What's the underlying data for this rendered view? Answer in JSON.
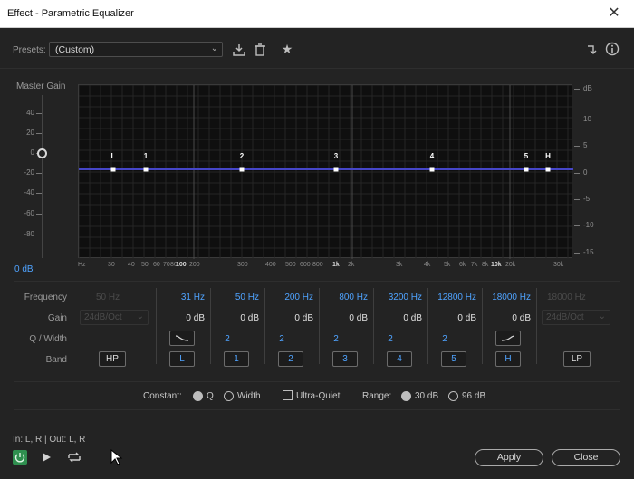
{
  "window": {
    "title": "Effect - Parametric Equalizer",
    "close_icon": "close-icon"
  },
  "presets": {
    "label": "Presets:",
    "value": "(Custom)"
  },
  "toolbar_icons": [
    "save-preset-icon",
    "delete-preset-icon",
    "favorite-star-icon",
    "routing-icon",
    "info-icon"
  ],
  "master_gain": {
    "label": "Master Gain",
    "value": "0 dB",
    "ticks": [
      "40",
      "20",
      "0",
      "-20",
      "-40",
      "-60",
      "-80"
    ]
  },
  "graph": {
    "db_ticks": [
      "dB",
      "10",
      "5",
      "0",
      "-5",
      "-10",
      "-15"
    ],
    "freq_ticks": [
      "Hz",
      "30",
      "40",
      "50",
      "60",
      "70",
      "80",
      "100",
      "200",
      "300",
      "400",
      "500",
      "600",
      "800",
      "1k",
      "2k",
      "3k",
      "4k",
      "5k",
      "6k",
      "7k",
      "8k",
      "10k",
      "20k",
      "30k"
    ],
    "handles": [
      "L",
      "1",
      "2",
      "3",
      "4",
      "5",
      "H"
    ]
  },
  "table": {
    "row_labels": {
      "frequency": "Frequency",
      "gain": "Gain",
      "q": "Q / Width",
      "band": "Band"
    },
    "hp": {
      "freq": "50 Hz",
      "gain": "24dB/Oct",
      "band": "HP"
    },
    "bands": [
      {
        "freq": "31 Hz",
        "gain": "0 dB",
        "band": "L"
      },
      {
        "freq": "50 Hz",
        "gain": "0 dB",
        "q": "2",
        "band": "1"
      },
      {
        "freq": "200 Hz",
        "gain": "0 dB",
        "q": "2",
        "band": "2"
      },
      {
        "freq": "800 Hz",
        "gain": "0 dB",
        "q": "2",
        "band": "3"
      },
      {
        "freq": "3200 Hz",
        "gain": "0 dB",
        "q": "2",
        "band": "4"
      },
      {
        "freq": "12800 Hz",
        "gain": "0 dB",
        "q": "2",
        "band": "5"
      },
      {
        "freq": "18000 Hz",
        "gain": "0 dB",
        "band": "H"
      }
    ],
    "lp": {
      "freq": "18000 Hz",
      "gain": "24dB/Oct",
      "band": "LP"
    }
  },
  "options": {
    "constant_label": "Constant:",
    "q_label": "Q",
    "width_label": "Width",
    "ultra_quiet": "Ultra-Quiet",
    "range_label": "Range:",
    "range_30": "30 dB",
    "range_96": "96 dB"
  },
  "footer": {
    "io": "In: L, R | Out: L, R",
    "apply": "Apply",
    "close": "Close"
  },
  "colors": {
    "accent": "#4fa3ff",
    "curve": "#4646c8",
    "power": "#3cb371"
  }
}
